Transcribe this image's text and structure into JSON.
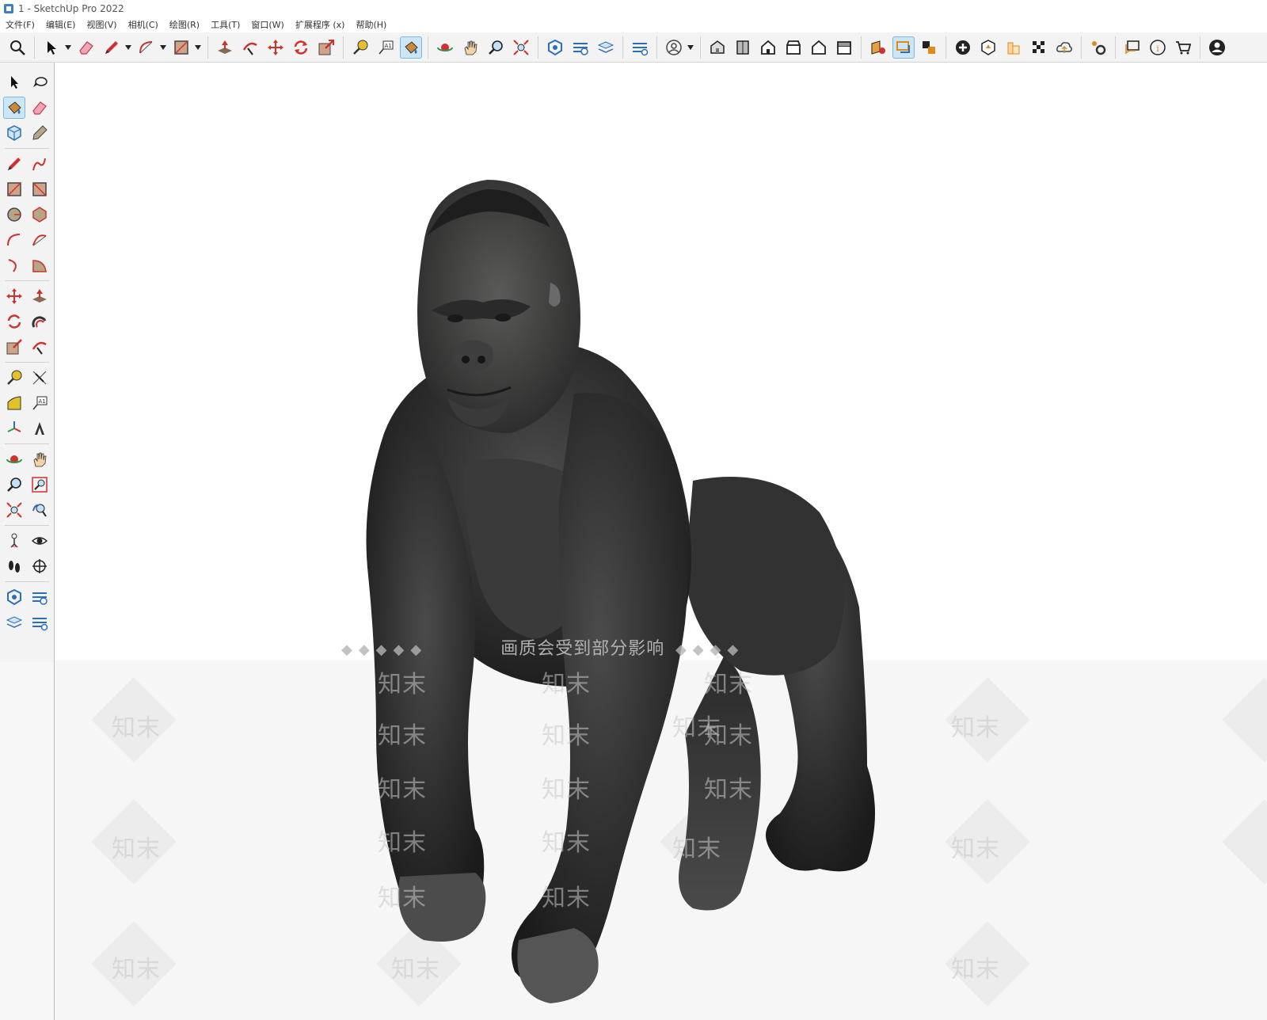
{
  "window": {
    "title": "1 - SketchUp Pro 2022"
  },
  "menu": {
    "items": [
      "文件(F)",
      "编辑(E)",
      "视图(V)",
      "相机(C)",
      "绘图(R)",
      "工具(T)",
      "窗口(W)",
      "扩展程序 (x)",
      "帮助(H)"
    ]
  },
  "toolbar": {
    "tools": [
      "search-icon",
      "select-icon",
      "eraser-icon",
      "pencil-icon",
      "arc-icon",
      "rectangle-icon",
      "push-pull-icon",
      "follow-me-icon",
      "move-icon",
      "rotate-icon",
      "scale-icon",
      "tape-measure-icon",
      "text-icon",
      "paint-bucket-icon",
      "orbit-icon",
      "pan-icon",
      "zoom-icon",
      "zoom-extents-icon",
      "3d-warehouse-icon",
      "extension-warehouse-icon",
      "layout-icon",
      "extension-manager-icon",
      "account-icon",
      "iso-view-icon",
      "top-view-icon",
      "front-view-icon",
      "right-view-icon",
      "back-view-icon",
      "left-view-icon",
      "section-plane-icon",
      "display-section-icon",
      "section-fill-icon",
      "add-location-icon",
      "toggle-terrain-icon",
      "match-photo-icon",
      "sandbox-icon",
      "upload-icon",
      "settings-icon",
      "message-icon",
      "info-icon",
      "cart-icon",
      "profile-icon"
    ]
  },
  "viewport": {
    "watermark_banner": "画质会受到部分影响",
    "watermark_brand": "知末"
  },
  "colors": {
    "accent": "#3b7fc4",
    "toolbar_bg": "#f3f3f3",
    "active_tool_bg": "#cde6f7",
    "icon_red": "#d0312d",
    "icon_blue": "#2a6fb8"
  }
}
